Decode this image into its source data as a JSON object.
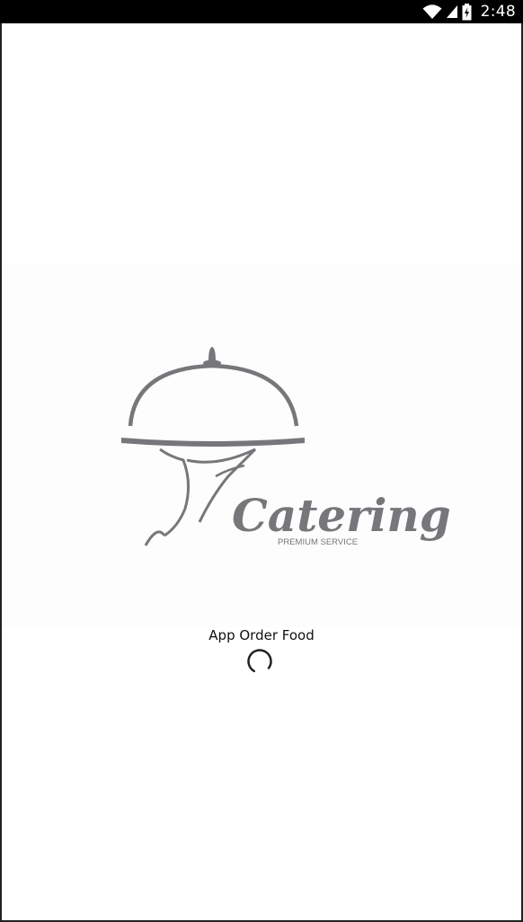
{
  "status_bar": {
    "time": "2:48",
    "icons": [
      "wifi-icon",
      "cell-signal-icon",
      "battery-charging-icon"
    ]
  },
  "splash": {
    "logo": {
      "wordmark": "Catering",
      "tagline": "PREMIUM SERVICE",
      "icon": "cloche-serving-hand-icon"
    },
    "app_name": "App Order Food",
    "loading_indicator": "progress-spinner-icon"
  },
  "colors": {
    "status_bar_bg": "#000000",
    "screen_bg": "#ffffff",
    "logo_gray": "#77777b",
    "text": "#111111"
  }
}
